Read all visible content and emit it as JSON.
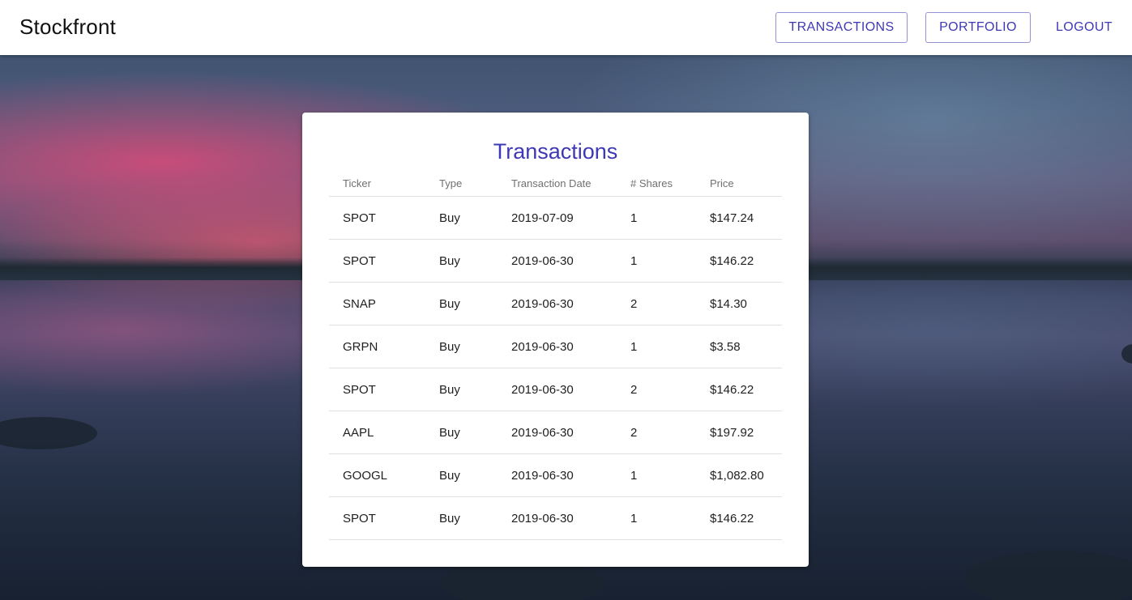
{
  "app": {
    "brand": "Stockfront"
  },
  "nav": {
    "transactions_label": "TRANSACTIONS",
    "portfolio_label": "PORTFOLIO",
    "logout_label": "LOGOUT"
  },
  "card": {
    "title": "Transactions",
    "columns": [
      "Ticker",
      "Type",
      "Transaction Date",
      "# Shares",
      "Price"
    ],
    "rows": [
      [
        "SPOT",
        "Buy",
        "2019-07-09",
        "1",
        "$147.24"
      ],
      [
        "SPOT",
        "Buy",
        "2019-06-30",
        "1",
        "$146.22"
      ],
      [
        "SNAP",
        "Buy",
        "2019-06-30",
        "2",
        "$14.30"
      ],
      [
        "GRPN",
        "Buy",
        "2019-06-30",
        "1",
        "$3.58"
      ],
      [
        "SPOT",
        "Buy",
        "2019-06-30",
        "2",
        "$146.22"
      ],
      [
        "AAPL",
        "Buy",
        "2019-06-30",
        "2",
        "$197.92"
      ],
      [
        "GOOGL",
        "Buy",
        "2019-06-30",
        "1",
        "$1,082.80"
      ],
      [
        "SPOT",
        "Buy",
        "2019-06-30",
        "1",
        "$146.22"
      ]
    ]
  },
  "colors": {
    "accent": "#3f38b5",
    "card_background": "#ffffff",
    "topbar_background": "#ffffff"
  }
}
